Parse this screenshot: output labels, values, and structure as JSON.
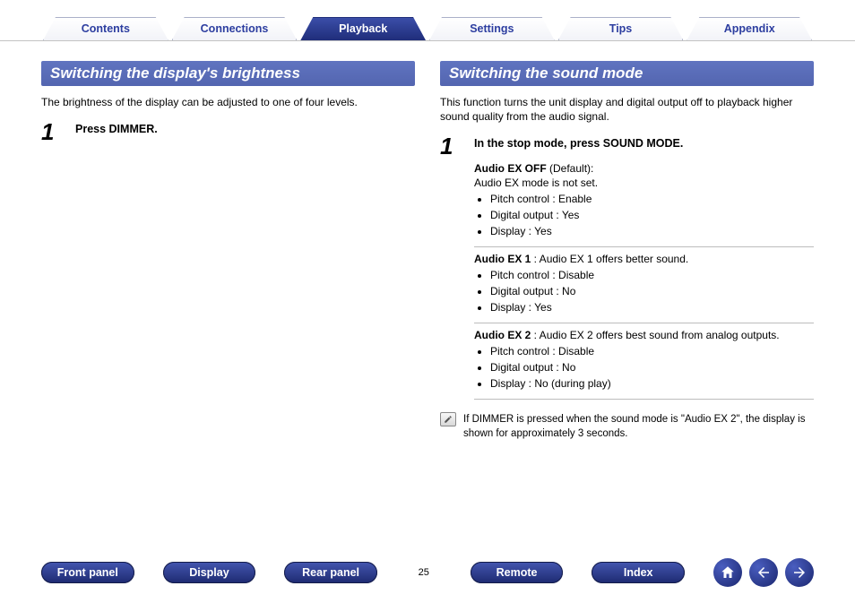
{
  "tabs": [
    "Contents",
    "Connections",
    "Playback",
    "Settings",
    "Tips",
    "Appendix"
  ],
  "active_tab_index": 2,
  "left": {
    "title": "Switching the display's brightness",
    "intro": "The brightness of the display can be adjusted to one of four levels.",
    "step_num": "1",
    "step_head": "Press DIMMER."
  },
  "right": {
    "title": "Switching the sound mode",
    "intro": "This function turns the unit display and digital output off to playback higher sound quality from the audio signal.",
    "step_num": "1",
    "step_head": "In the stop mode, press SOUND MODE.",
    "modes": [
      {
        "name": "Audio EX OFF",
        "suffix": " (Default):",
        "sub": "Audio EX mode is not set.",
        "props": [
          "Pitch control : Enable",
          "Digital output : Yes",
          "Display : Yes"
        ]
      },
      {
        "name": "Audio EX 1",
        "suffix": " : Audio EX 1 offers better sound.",
        "sub": "",
        "props": [
          "Pitch control : Disable",
          "Digital output : No",
          "Display : Yes"
        ]
      },
      {
        "name": "Audio EX 2",
        "suffix": " : Audio EX 2 offers best sound from analog outputs.",
        "sub": "",
        "props": [
          "Pitch control : Disable",
          "Digital output : No",
          "Display : No (during play)"
        ]
      }
    ],
    "note": "If DIMMER is pressed when the sound mode is \"Audio EX 2\", the display is shown for approximately 3 seconds."
  },
  "bottom_pills": [
    "Front panel",
    "Display",
    "Rear panel"
  ],
  "page_number": "25",
  "bottom_pills2": [
    "Remote",
    "Index"
  ]
}
